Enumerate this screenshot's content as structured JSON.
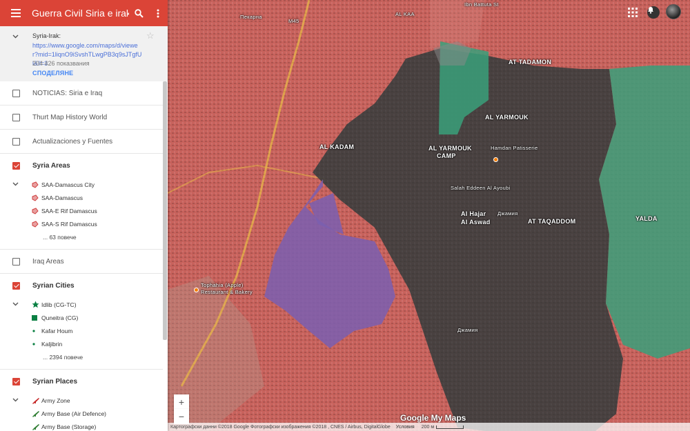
{
  "app": {
    "title": "Guerra Civil Siria e irak"
  },
  "info": {
    "map_name": "Syria-Irak:",
    "link": "https://www.google.com/maps/d/viewer?mid=1liqnO9iSvshTLwgPB3q9sJTgfUl&ll=3",
    "views": "204 426 показвания",
    "share": "СПОДЕЛЯНЕ"
  },
  "layers": [
    {
      "label": "NOTICIAS: Siria e Iraq",
      "checked": false
    },
    {
      "label": "Thurt Map History World",
      "checked": false
    },
    {
      "label": "Actualizaciones y Fuentes",
      "checked": false
    }
  ],
  "syria_areas": {
    "label": "Syria Areas",
    "items": [
      "SAA-Damascus City",
      "SAA-Damascus",
      "SAA-E Rif Damascus",
      "SAA-S Rif Damascus"
    ],
    "more": "... 63 повече"
  },
  "iraq_areas": {
    "label": "Iraq Areas"
  },
  "syrian_cities": {
    "label": "Syrian Cities",
    "items": [
      "Idlib (CG-TC)",
      "Quneitra (CG)",
      "Kafar Houm",
      "Kaljibrin"
    ],
    "more": "... 2394 повече"
  },
  "syrian_places": {
    "label": "Syrian Places",
    "items": [
      "Army Zone",
      "Army Base (Air Defence)",
      "Army Base (Storage)"
    ]
  },
  "map": {
    "labels": {
      "al_kaa": "AL KAA",
      "at_tadamon": "AT TADAMON",
      "al_yarmouk": "AL YARMOUK",
      "al_yarmouk_camp_1": "AL YARMOUK",
      "al_yarmouk_camp_2": "CAMP",
      "al_kadam": "AL KADAM",
      "hamdan": "Hamdan Patisserie",
      "salah": "Salah Eddeen Al Ayoubi",
      "al_hajar": "Al Hajar",
      "al_aswad": "Al Aswad",
      "at_taqaddom": "AT TAQADDOM",
      "yalda": "YALDA",
      "tophahia_1": "Tophahia (Apple)",
      "tophahia_2": "Restaurant & Bakery",
      "pekarna": "Пекарна",
      "dzhamiya_1": "Джамия",
      "dzhamiya_2": "Джамия",
      "m45": "M45",
      "ibn": "Ibn Battuta St"
    },
    "logo": "Google My Maps",
    "attribution": "Картографски данни ©2018 Google Фотографски изображения ©2018 , CNES / Airbus, DigitalGlobe",
    "terms": "Условия",
    "scale": "200 м",
    "zoom_in": "+",
    "zoom_out": "−"
  },
  "colors": {
    "header": "#db4437",
    "red_zone": "#c8625c",
    "dark_zone": "#3e3e3e",
    "green_zone": "#3aa07a",
    "purple_zone": "#7a5fb0"
  },
  "icons": {
    "menu": "menu-icon",
    "search": "search-icon",
    "more": "more-vert-icon",
    "grid": "apps-grid-icon"
  }
}
